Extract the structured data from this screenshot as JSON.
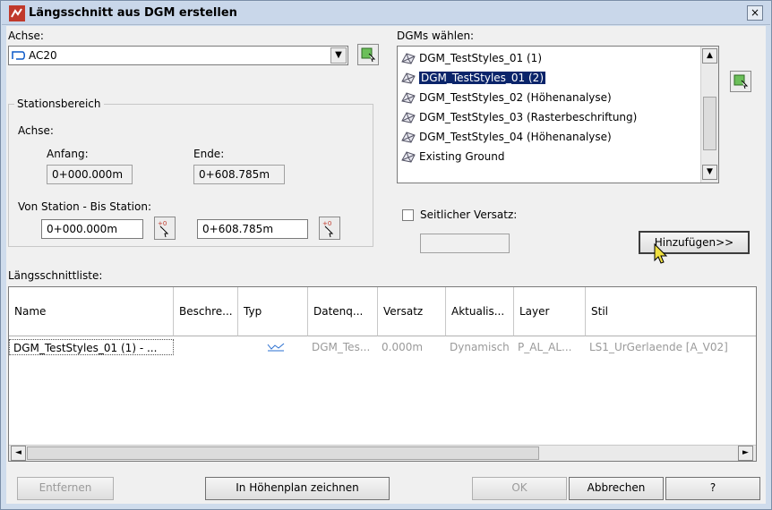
{
  "window": {
    "title": "Längsschnitt aus DGM erstellen",
    "close_label": "×"
  },
  "achse": {
    "label": "Achse:",
    "selected": "AC20",
    "group_title": "Stationsbereich",
    "sub_label": "Achse:",
    "anfang_label": "Anfang:",
    "anfang_value": "0+000.000m",
    "ende_label": "Ende:",
    "ende_value": "0+608.785m",
    "range_label": "Von Station - Bis Station:",
    "von_value": "0+000.000m",
    "bis_value": "0+608.785m"
  },
  "dgms": {
    "label": "DGMs wählen:",
    "items": [
      {
        "label": "DGM_TestStyles_01 (1)",
        "selected": false
      },
      {
        "label": "DGM_TestStyles_01 (2)",
        "selected": true
      },
      {
        "label": "DGM_TestStyles_02 (Höhenanalyse)",
        "selected": false
      },
      {
        "label": "DGM_TestStyles_03 (Rasterbeschriftung)",
        "selected": false
      },
      {
        "label": "DGM_TestStyles_04 (Höhenanalyse)",
        "selected": false
      },
      {
        "label": "Existing Ground",
        "selected": false
      }
    ],
    "offset_label": "Seitlicher Versatz:",
    "offset_value": "",
    "add_button": "Hinzufügen>>"
  },
  "list": {
    "label": "Längsschnittliste:",
    "columns": [
      "Name",
      "Beschre...",
      "Typ",
      "Datenq...",
      "Versatz",
      "Aktualis...",
      "Layer",
      "Stil"
    ],
    "rows": [
      [
        "DGM_TestStyles_01 (1) - ...",
        "",
        "",
        "DGM_Tes...",
        "0.000m",
        "Dynamisch",
        "P_AL_AL...",
        "LS1_UrGerlaende [A_V02]"
      ]
    ]
  },
  "buttons": {
    "remove": "Entfernen",
    "draw": "In Höhenplan zeichnen",
    "ok": "OK",
    "cancel": "Abbrechen",
    "help": "?"
  },
  "colors": {
    "selection": "#0a246a",
    "titlebar": "#c9d7ea"
  }
}
